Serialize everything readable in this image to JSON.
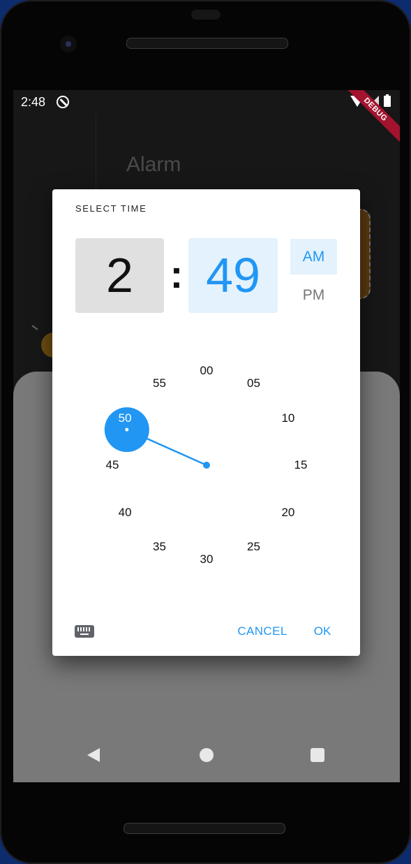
{
  "status_bar": {
    "time": "2:48"
  },
  "debug_banner": "DEBUG",
  "background": {
    "title": "Alarm"
  },
  "dialog": {
    "title": "SELECT TIME",
    "hour": "2",
    "separator": ":",
    "minute": "49",
    "am_label": "AM",
    "pm_label": "PM",
    "period_selected": "AM",
    "dial": {
      "ticks": [
        "00",
        "05",
        "10",
        "15",
        "20",
        "25",
        "30",
        "35",
        "40",
        "45",
        "50",
        "55"
      ],
      "selected_tick": "50",
      "hand_minute": 49,
      "accent_color": "#2196f3"
    },
    "cancel_label": "CANCEL",
    "ok_label": "OK",
    "keyboard_icon": "keyboard-icon"
  },
  "navigation": {
    "back_icon": "back-triangle-icon",
    "home_icon": "home-circle-icon",
    "recents_icon": "recents-square-icon"
  }
}
